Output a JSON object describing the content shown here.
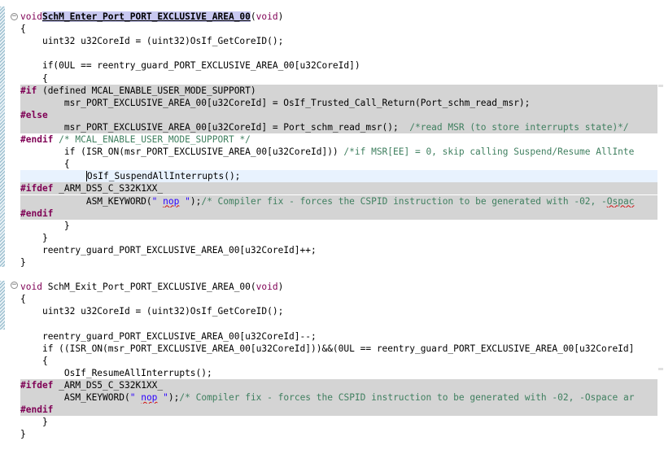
{
  "editor": {
    "lines": [
      {
        "i": "",
        "t": [
          [
            "ty",
            "void"
          ],
          [
            "",
            ""
          ],
          [
            "sel",
            "SchM_Enter_Port_PORT_EXCLUSIVE_AREA_00"
          ],
          [
            "",
            "("
          ],
          [
            "ty",
            "void"
          ],
          [
            "",
            ")"
          ]
        ]
      },
      {
        "i": "",
        "t": [
          [
            "",
            "{"
          ]
        ]
      },
      {
        "i": "    ",
        "t": [
          [
            "",
            "uint32 u32CoreId = (uint32)OsIf_GetCoreID();"
          ]
        ]
      },
      {
        "i": "",
        "t": [
          [
            "",
            ""
          ]
        ]
      },
      {
        "i": "    ",
        "t": [
          [
            "",
            "if(0UL == reentry_guard_PORT_EXCLUSIVE_AREA_00[u32CoreId])"
          ]
        ]
      },
      {
        "i": "    ",
        "t": [
          [
            "",
            "{"
          ]
        ]
      },
      {
        "i": "",
        "t": [
          [
            "kw",
            "#if"
          ],
          [
            "",
            " (defined MCAL_ENABLE_USER_MODE_SUPPORT)"
          ]
        ]
      },
      {
        "i": "        ",
        "t": [
          [
            "",
            "msr_PORT_EXCLUSIVE_AREA_00[u32CoreId] = OsIf_Trusted_Call_Return(Port_schm_read_msr);"
          ]
        ]
      },
      {
        "i": "",
        "t": [
          [
            "kw",
            "#else"
          ]
        ]
      },
      {
        "i": "        ",
        "t": [
          [
            "",
            "msr_PORT_EXCLUSIVE_AREA_00[u32CoreId] = Port_schm_read_msr();  "
          ],
          [
            "cm",
            "/*read MSR (to store interrupts state)*/"
          ]
        ]
      },
      {
        "i": "",
        "t": [
          [
            "kw",
            "#endif"
          ],
          [
            "",
            " "
          ],
          [
            "cm",
            "/* MCAL_ENABLE_USER_MODE_SUPPORT */"
          ]
        ]
      },
      {
        "i": "        ",
        "t": [
          [
            "",
            "if (ISR_ON(msr_PORT_EXCLUSIVE_AREA_00[u32CoreId])) "
          ],
          [
            "cm",
            "/*if MSR[EE] = 0, skip calling Suspend/Resume AllInte"
          ]
        ]
      },
      {
        "i": "        ",
        "t": [
          [
            "",
            "{"
          ]
        ]
      },
      {
        "i": "            ",
        "t": [
          [
            "caret",
            ""
          ],
          [
            "",
            "OsIf_SuspendAllInterrupts();"
          ]
        ]
      },
      {
        "i": "",
        "t": [
          [
            "kw",
            "#ifdef"
          ],
          [
            "",
            " _ARM_DS5_C_S32K1XX_"
          ]
        ]
      },
      {
        "i": "            ",
        "t": [
          [
            "",
            "ASM_KEYWORD("
          ],
          [
            "st",
            "\" "
          ],
          [
            "st sq",
            "nop"
          ],
          [
            "st",
            " \""
          ],
          [
            "",
            ");"
          ],
          [
            "cm",
            "/* Compiler fix - forces the CSPID instruction to be generated with -02, -"
          ],
          [
            "cm sq",
            "Ospac"
          ]
        ]
      },
      {
        "i": "",
        "t": [
          [
            "kw",
            "#endif"
          ]
        ]
      },
      {
        "i": "        ",
        "t": [
          [
            "",
            "}"
          ]
        ]
      },
      {
        "i": "    ",
        "t": [
          [
            "",
            "}"
          ]
        ]
      },
      {
        "i": "    ",
        "t": [
          [
            "",
            "reentry_guard_PORT_EXCLUSIVE_AREA_00[u32CoreId]++;"
          ]
        ]
      },
      {
        "i": "",
        "t": [
          [
            "",
            "}"
          ]
        ]
      },
      {
        "i": "",
        "t": [
          [
            "",
            ""
          ]
        ]
      },
      {
        "i": "",
        "t": [
          [
            "ty",
            "void"
          ],
          [
            "",
            " SchM_Exit_Port_PORT_EXCLUSIVE_AREA_00("
          ],
          [
            "ty",
            "void"
          ],
          [
            "",
            ")"
          ]
        ]
      },
      {
        "i": "",
        "t": [
          [
            "",
            "{"
          ]
        ]
      },
      {
        "i": "    ",
        "t": [
          [
            "",
            "uint32 u32CoreId = (uint32)OsIf_GetCoreID();"
          ]
        ]
      },
      {
        "i": "",
        "t": [
          [
            "",
            ""
          ]
        ]
      },
      {
        "i": "    ",
        "t": [
          [
            "",
            "reentry_guard_PORT_EXCLUSIVE_AREA_00[u32CoreId]--;"
          ]
        ]
      },
      {
        "i": "    ",
        "t": [
          [
            "",
            "if ((ISR_ON(msr_PORT_EXCLUSIVE_AREA_00[u32CoreId]))&&(0UL == reentry_guard_PORT_EXCLUSIVE_AREA_00[u32CoreId]"
          ]
        ]
      },
      {
        "i": "    ",
        "t": [
          [
            "",
            "{"
          ]
        ]
      },
      {
        "i": "        ",
        "t": [
          [
            "",
            "OsIf_ResumeAllInterrupts();"
          ]
        ]
      },
      {
        "i": "",
        "t": [
          [
            "kw",
            "#ifdef"
          ],
          [
            "",
            " _ARM_DS5_C_S32K1XX_"
          ]
        ]
      },
      {
        "i": "        ",
        "t": [
          [
            "",
            "ASM_KEYWORD("
          ],
          [
            "st",
            "\" "
          ],
          [
            "st sq",
            "nop"
          ],
          [
            "st",
            " \""
          ],
          [
            "",
            ");"
          ],
          [
            "cm",
            "/* Compiler fix - forces the CSPID instruction to be generated with -02, -Ospace ar"
          ]
        ]
      },
      {
        "i": "",
        "t": [
          [
            "kw",
            "#endif"
          ]
        ]
      },
      {
        "i": "    ",
        "t": [
          [
            "",
            "}"
          ]
        ]
      },
      {
        "i": "",
        "t": [
          [
            "",
            "}"
          ]
        ]
      }
    ]
  },
  "fold_icons": [
    "minus-icon",
    "minus-icon"
  ]
}
